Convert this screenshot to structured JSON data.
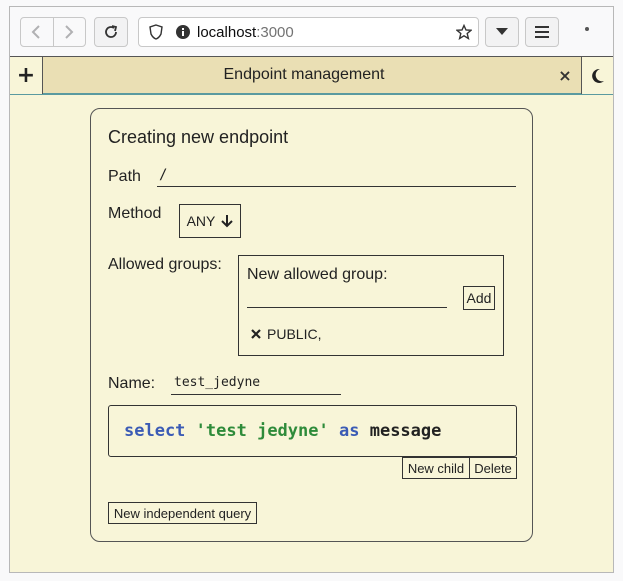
{
  "browser": {
    "url_host": "localhost",
    "url_port": ":3000"
  },
  "tabs": {
    "title": "Endpoint management",
    "add_label": "+",
    "close_label": "×"
  },
  "form": {
    "title": "Creating new endpoint",
    "path_label": "Path",
    "path_value": "/",
    "method_label": "Method",
    "method_value": "ANY",
    "allowed_groups_label": "Allowed groups:",
    "new_group_label": "New allowed group:",
    "new_group_value": "",
    "add_button": "Add",
    "groups": [
      "PUBLIC,"
    ],
    "name_label": "Name:",
    "name_value": "test_jedyne",
    "query": {
      "kw_select": "select",
      "string": "'test jedyne'",
      "kw_as": "as",
      "ident": "message"
    },
    "new_child_button": "New child",
    "delete_button": "Delete",
    "new_independent_query_button": "New independent query"
  }
}
